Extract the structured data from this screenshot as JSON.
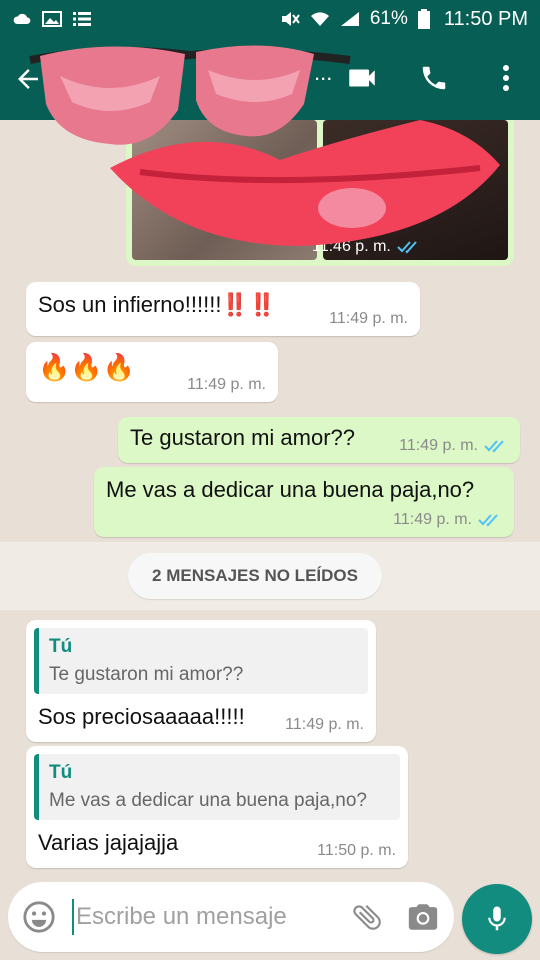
{
  "status_bar": {
    "battery": "61%",
    "time": "11:50 PM"
  },
  "colors": {
    "header": "#075e54",
    "accent": "#128c7e",
    "outgoing_bubble": "#dcf8c6",
    "incoming_bubble": "#ffffff",
    "read_ticks": "#4fc3f7"
  },
  "icons": {
    "back": "arrow-left-icon",
    "video": "video-camera-icon",
    "call": "phone-icon",
    "menu": "more-vertical-icon",
    "emoji": "emoji-icon",
    "attach": "paperclip-icon",
    "camera": "camera-icon",
    "mic": "microphone-icon"
  },
  "header": {
    "title_dots": "..."
  },
  "messages": {
    "image_time": "11:46 p. m.",
    "m1_text": "Sos un infierno!!!!!!‼️‼️",
    "m1_time": "11:49 p. m.",
    "m2_text": "🔥🔥🔥",
    "m2_time": "11:49 p. m.",
    "m3_text": "Te gustaron mi amor??",
    "m3_time": "11:49 p. m.",
    "m4_text": "Me vas a dedicar una buena paja,no?",
    "m4_time": "11:49 p. m.",
    "unread_label": "2 MENSAJES NO LEÍDOS",
    "m5_quote_author": "Tú",
    "m5_quote_text": "Te gustaron mi amor??",
    "m5_text": "Sos preciosaaaaa!!!!!",
    "m5_time": "11:49 p. m.",
    "m6_quote_author": "Tú",
    "m6_quote_text": "Me vas a dedicar una buena paja,no?",
    "m6_text": "Varias jajajajja",
    "m6_time": "11:50 p. m."
  },
  "composer": {
    "placeholder": "Escribe un mensaje"
  }
}
